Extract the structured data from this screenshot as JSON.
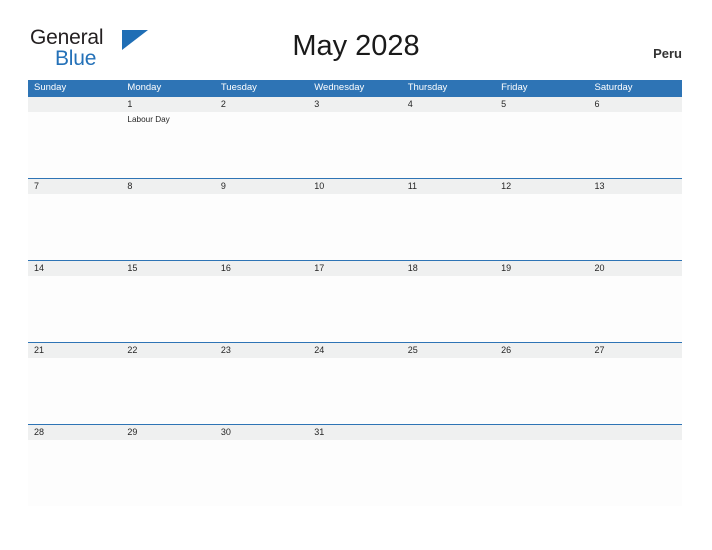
{
  "brand": {
    "name_part1": "General",
    "name_part2": "Blue",
    "triangle_icon": "blue-triangle-icon",
    "primary_color": "#2e74b5",
    "dark_text_color": "#231f20"
  },
  "header": {
    "title": "May 2028",
    "country": "Peru"
  },
  "calendar": {
    "weekdays": [
      "Sunday",
      "Monday",
      "Tuesday",
      "Wednesday",
      "Thursday",
      "Friday",
      "Saturday"
    ],
    "weeks": [
      [
        {
          "date": "",
          "events": []
        },
        {
          "date": "1",
          "events": [
            "Labour Day"
          ]
        },
        {
          "date": "2",
          "events": []
        },
        {
          "date": "3",
          "events": []
        },
        {
          "date": "4",
          "events": []
        },
        {
          "date": "5",
          "events": []
        },
        {
          "date": "6",
          "events": []
        }
      ],
      [
        {
          "date": "7",
          "events": []
        },
        {
          "date": "8",
          "events": []
        },
        {
          "date": "9",
          "events": []
        },
        {
          "date": "10",
          "events": []
        },
        {
          "date": "11",
          "events": []
        },
        {
          "date": "12",
          "events": []
        },
        {
          "date": "13",
          "events": []
        }
      ],
      [
        {
          "date": "14",
          "events": []
        },
        {
          "date": "15",
          "events": []
        },
        {
          "date": "16",
          "events": []
        },
        {
          "date": "17",
          "events": []
        },
        {
          "date": "18",
          "events": []
        },
        {
          "date": "19",
          "events": []
        },
        {
          "date": "20",
          "events": []
        }
      ],
      [
        {
          "date": "21",
          "events": []
        },
        {
          "date": "22",
          "events": []
        },
        {
          "date": "23",
          "events": []
        },
        {
          "date": "24",
          "events": []
        },
        {
          "date": "25",
          "events": []
        },
        {
          "date": "26",
          "events": []
        },
        {
          "date": "27",
          "events": []
        }
      ],
      [
        {
          "date": "28",
          "events": []
        },
        {
          "date": "29",
          "events": []
        },
        {
          "date": "30",
          "events": []
        },
        {
          "date": "31",
          "events": []
        },
        {
          "date": "",
          "events": []
        },
        {
          "date": "",
          "events": []
        },
        {
          "date": "",
          "events": []
        }
      ]
    ]
  }
}
